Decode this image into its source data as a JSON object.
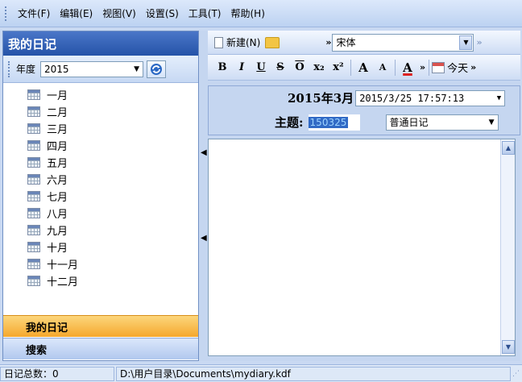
{
  "menu": [
    "文件(F)",
    "编辑(E)",
    "视图(V)",
    "设置(S)",
    "工具(T)",
    "帮助(H)"
  ],
  "left": {
    "title": "我的日记",
    "year_label": "年度",
    "year_value": "2015",
    "months": [
      "一月",
      "二月",
      "三月",
      "四月",
      "五月",
      "六月",
      "七月",
      "八月",
      "九月",
      "十月",
      "十一月",
      "十二月"
    ],
    "nav_diary": "我的日记",
    "nav_search": "搜索"
  },
  "toolbar": {
    "new_label": "新建(N)",
    "font_value": "宋体",
    "today_label": "今天",
    "fmt_bold": "B",
    "fmt_italic": "I",
    "fmt_underline": "U",
    "fmt_strike": "S",
    "fmt_overline": "O",
    "fmt_sub": "x₂",
    "fmt_sup": "x²",
    "fmt_grow": "A",
    "fmt_shrink": "A",
    "fmt_color": "A"
  },
  "form": {
    "date_title": "2015年3月",
    "datetime_value": "2015/3/25 17:57:13",
    "subject_label": "主题:",
    "subject_value": "150325",
    "type_value": "普通日记"
  },
  "status": {
    "count": "日记总数：0",
    "path": "D:\\用户目录\\Documents\\mydiary.kdf"
  },
  "colors": {
    "accent_blue": "#2553a8",
    "nav_active": "#f5a82d",
    "selection": "#316ac5"
  }
}
